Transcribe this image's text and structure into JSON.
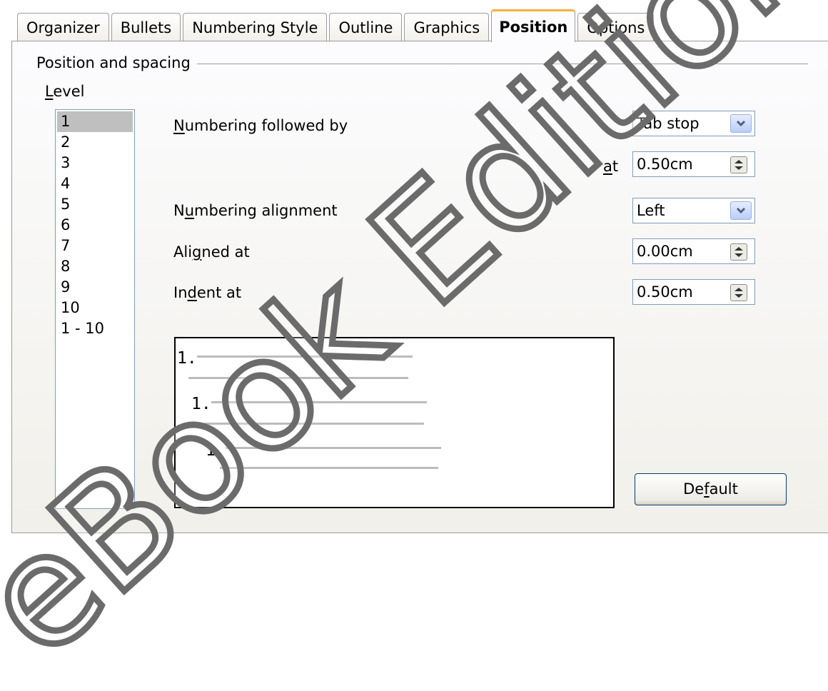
{
  "tabs": [
    {
      "label": "Organizer",
      "active": false
    },
    {
      "label": "Bullets",
      "active": false
    },
    {
      "label": "Numbering Style",
      "active": false
    },
    {
      "label": "Outline",
      "active": false
    },
    {
      "label": "Graphics",
      "active": false
    },
    {
      "label": "Position",
      "active": true
    },
    {
      "label": "Options",
      "active": false
    }
  ],
  "section": {
    "title": "Position and spacing",
    "level_label_hotkey": "L",
    "level_label_rest": "evel"
  },
  "levels": [
    "1",
    "2",
    "3",
    "4",
    "5",
    "6",
    "7",
    "8",
    "9",
    "10",
    "1 - 10"
  ],
  "selected_level": "1",
  "fields": {
    "numbering_followed_by": {
      "label_hotkey": "N",
      "label_rest": "umbering followed by",
      "value": "Tab stop"
    },
    "at": {
      "label_hotkey": "a",
      "label_rest": "t",
      "value": "0.50cm"
    },
    "numbering_alignment": {
      "label_pre": "N",
      "label_hotkey": "u",
      "label_rest": "mbering alignment",
      "value": "Left"
    },
    "aligned_at": {
      "label_pre": "Ali",
      "label_hotkey": "g",
      "label_rest": "ned at",
      "value": "0.00cm"
    },
    "indent_at": {
      "label_pre": "In",
      "label_hotkey": "d",
      "label_rest": "ent at",
      "value": "0.50cm"
    }
  },
  "preview": {
    "number_label": "1."
  },
  "buttons": {
    "default_pre": "De",
    "default_hotkey": "f",
    "default_rest": "ault"
  },
  "watermark": "eBook Edition",
  "icons": {
    "dropdown": "chevron-down-icon",
    "spin": "spin-updown-icon"
  },
  "colors": {
    "active_tab_accent": "#f4b13e",
    "field_border": "#7f9db9",
    "selection": "#bfbfbf"
  }
}
